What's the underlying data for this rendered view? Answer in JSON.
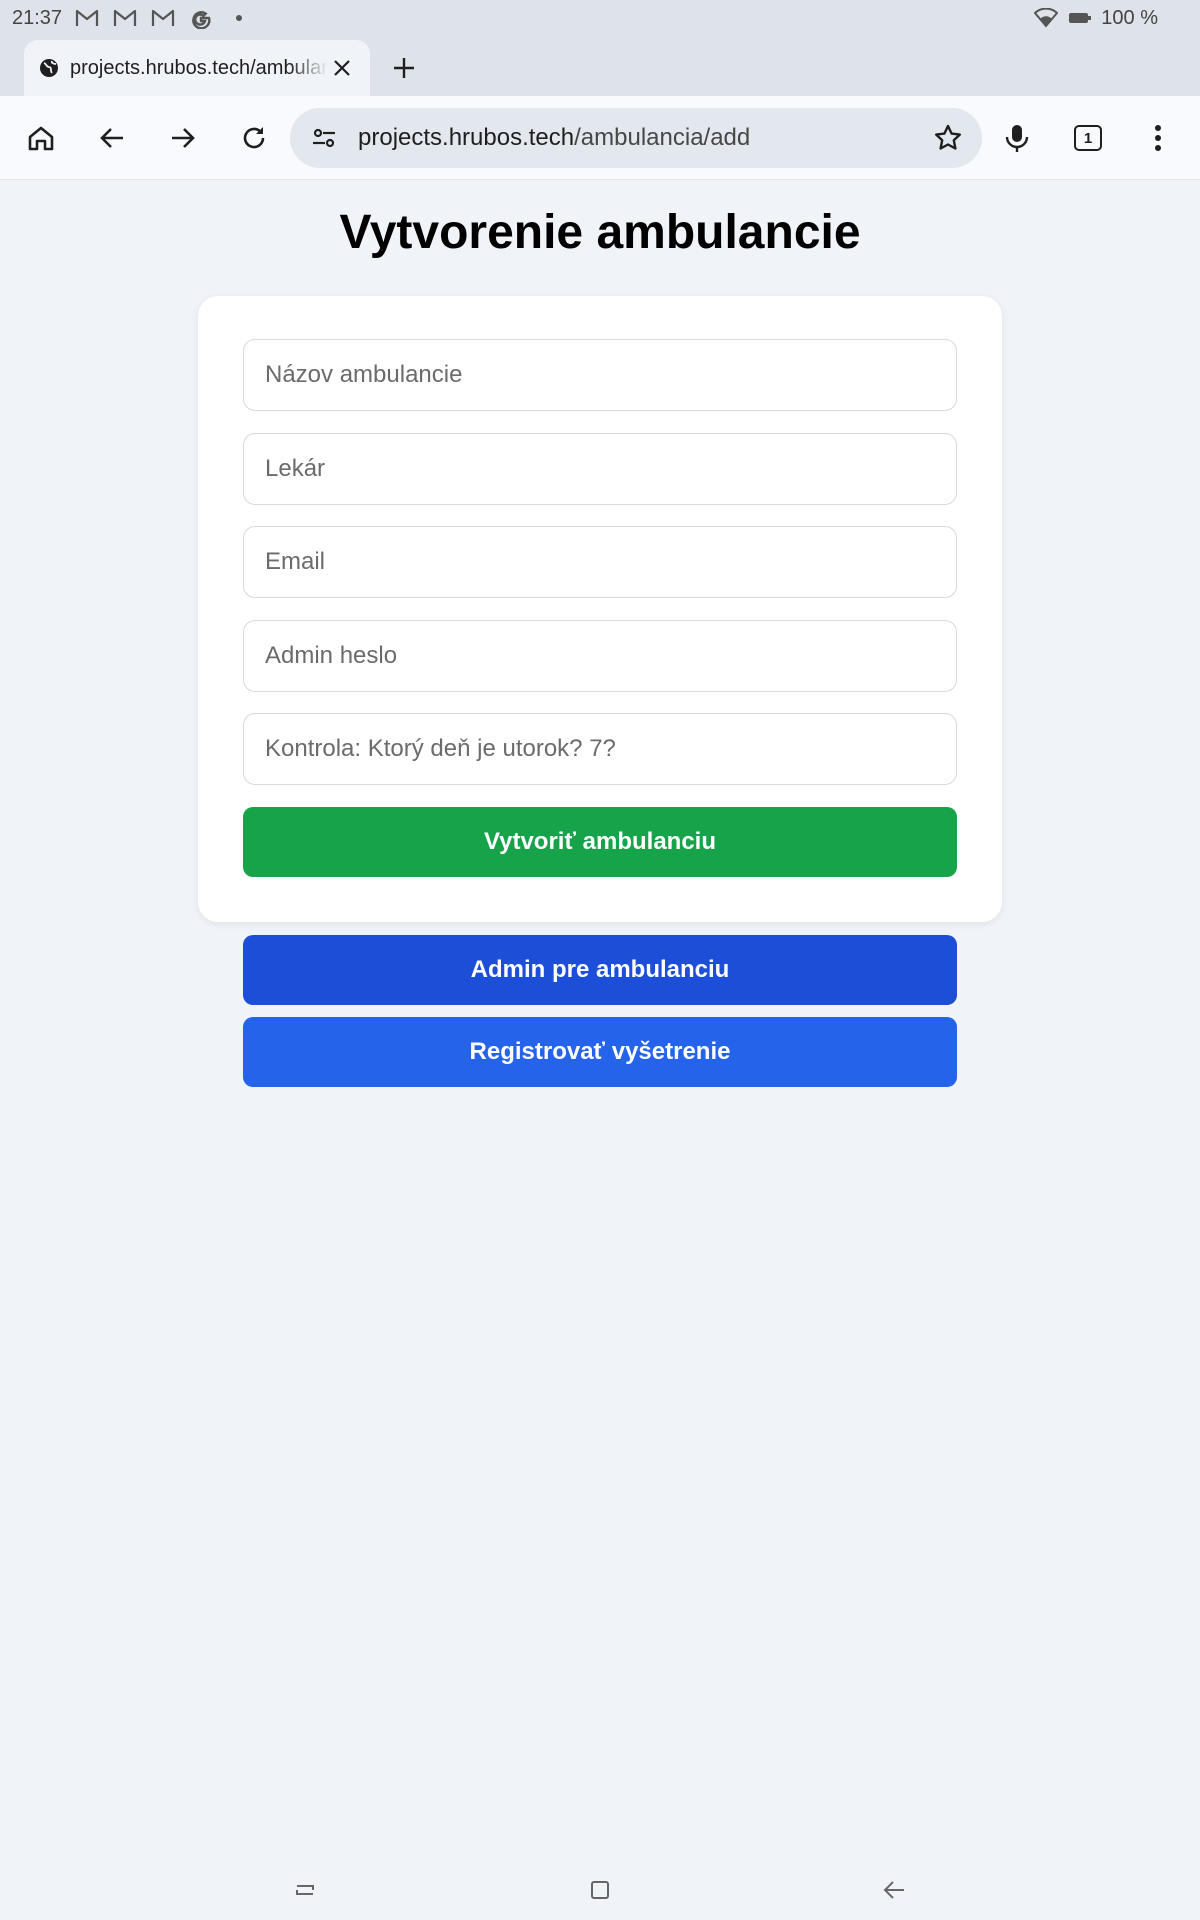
{
  "status_bar": {
    "time": "21:37",
    "notification_icons": [
      "gmail-icon",
      "gmail-icon",
      "gmail-icon",
      "google-icon"
    ],
    "battery": "100 %"
  },
  "tab": {
    "title": "projects.hrubos.tech/ambulancia/add"
  },
  "omnibox": {
    "host": "projects.hrubos.tech",
    "path": "/ambulancia/add"
  },
  "toolbar": {
    "tab_count": "1"
  },
  "page": {
    "title": "Vytvorenie ambulancie",
    "form": {
      "name_placeholder": "Názov ambulancie",
      "doctor_placeholder": "Lekár",
      "email_placeholder": "Email",
      "password_placeholder": "Admin heslo",
      "captcha_placeholder": "Kontrola: Ktorý deň je utorok? 7?",
      "submit_label": "Vytvoriť ambulanciu"
    },
    "admin_button_label": "Admin pre ambulanciu",
    "register_button_label": "Registrovať vyšetrenie"
  },
  "colors": {
    "background": "#f0f4f9",
    "create_button": "#16a34a",
    "admin_button": "#1d4ed8",
    "register_button": "#2563eb"
  }
}
